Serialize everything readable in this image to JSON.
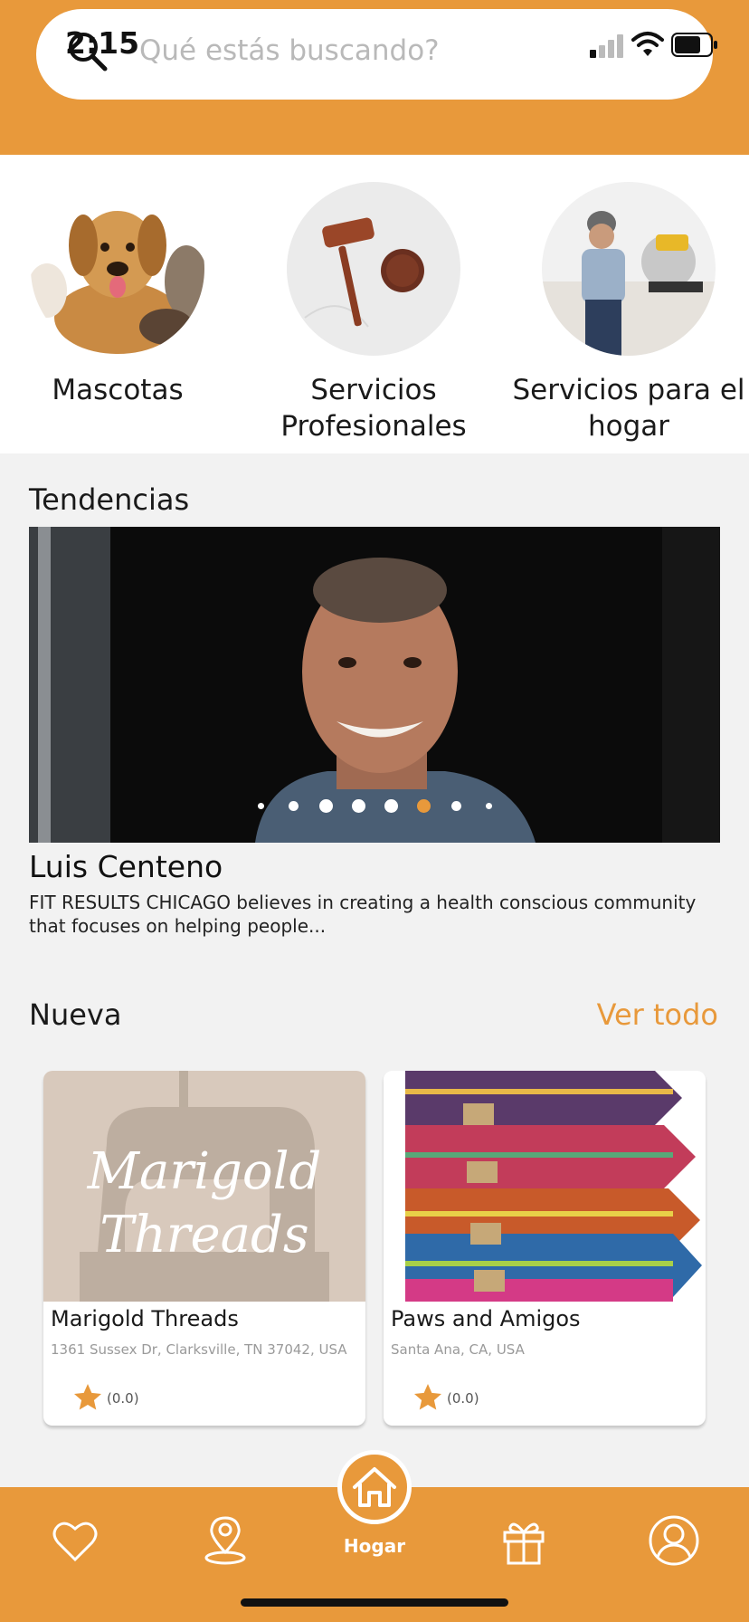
{
  "status_bar": {
    "time": "2:15"
  },
  "search": {
    "placeholder": "Qué estás buscando?"
  },
  "categories": [
    {
      "label": "Mascotas"
    },
    {
      "label": "Servicios Profesionales"
    },
    {
      "label": "Servicios para el hogar"
    }
  ],
  "trending": {
    "title": "Tendencias",
    "name": "Luis Centeno",
    "description": "FIT RESULTS CHICAGO believes in creating a health conscious community that focuses on helping people...",
    "pager": {
      "count": 8,
      "active": 6
    }
  },
  "new_section": {
    "title": "Nueva",
    "see_all": "Ver todo",
    "cards": [
      {
        "name": "Marigold Threads",
        "address": "1361 Sussex Dr, Clarksville, TN 37042, USA",
        "rating": "(0.0)",
        "logo_text": "Marigold Threads"
      },
      {
        "name": "Paws and Amigos",
        "address": "Santa Ana, CA, USA",
        "rating": "(0.0)"
      }
    ]
  },
  "bottom_nav": {
    "home_label": "Hogar",
    "items": [
      "heart-icon",
      "map-pin-icon",
      "home-icon",
      "gift-icon",
      "profile-icon"
    ]
  },
  "colors": {
    "accent": "#e8993b",
    "background": "#f2f2f2",
    "card": "#ffffff"
  }
}
